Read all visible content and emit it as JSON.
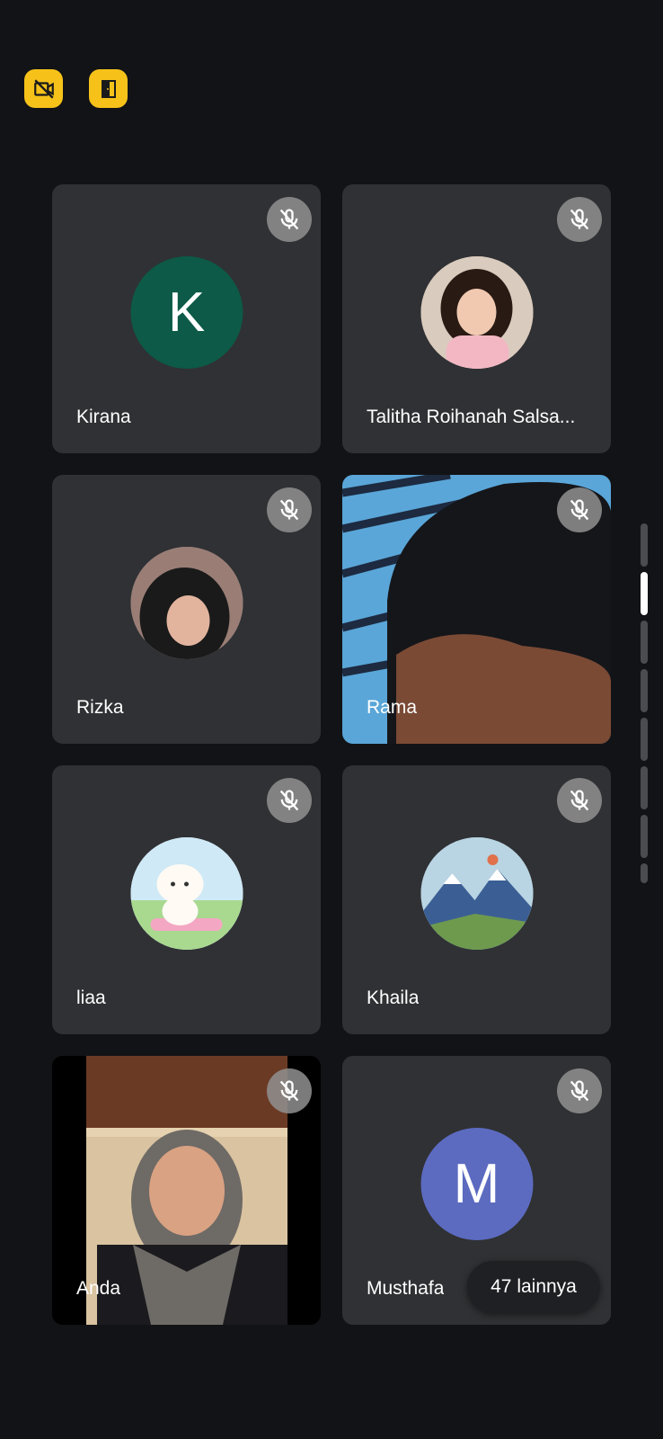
{
  "toolbar": {
    "icons": [
      "camera-off-icon",
      "door-icon"
    ],
    "accent": "#f6c21a"
  },
  "participants": [
    {
      "name": "Kirana",
      "avatar": "initial",
      "initial": "K",
      "color": "#0c5a47",
      "muted": true
    },
    {
      "name": "Talitha Roihanah Salsa...",
      "avatar": "photo",
      "muted": true
    },
    {
      "name": "Rizka",
      "avatar": "photo",
      "muted": true
    },
    {
      "name": "Rama",
      "avatar": "video",
      "muted": true
    },
    {
      "name": "liaa",
      "avatar": "photo",
      "muted": true
    },
    {
      "name": "Khaila",
      "avatar": "photo",
      "muted": true
    },
    {
      "name": "Anda",
      "avatar": "video",
      "muted": true
    },
    {
      "name": "Musthafa",
      "avatar": "initial",
      "initial": "M",
      "color": "#5c6bc0",
      "muted": true
    }
  ],
  "overflow": {
    "label": "47 lainnya"
  },
  "colors": {
    "background": "#121316",
    "tile": "#303134",
    "mute_badge": "#919191"
  }
}
